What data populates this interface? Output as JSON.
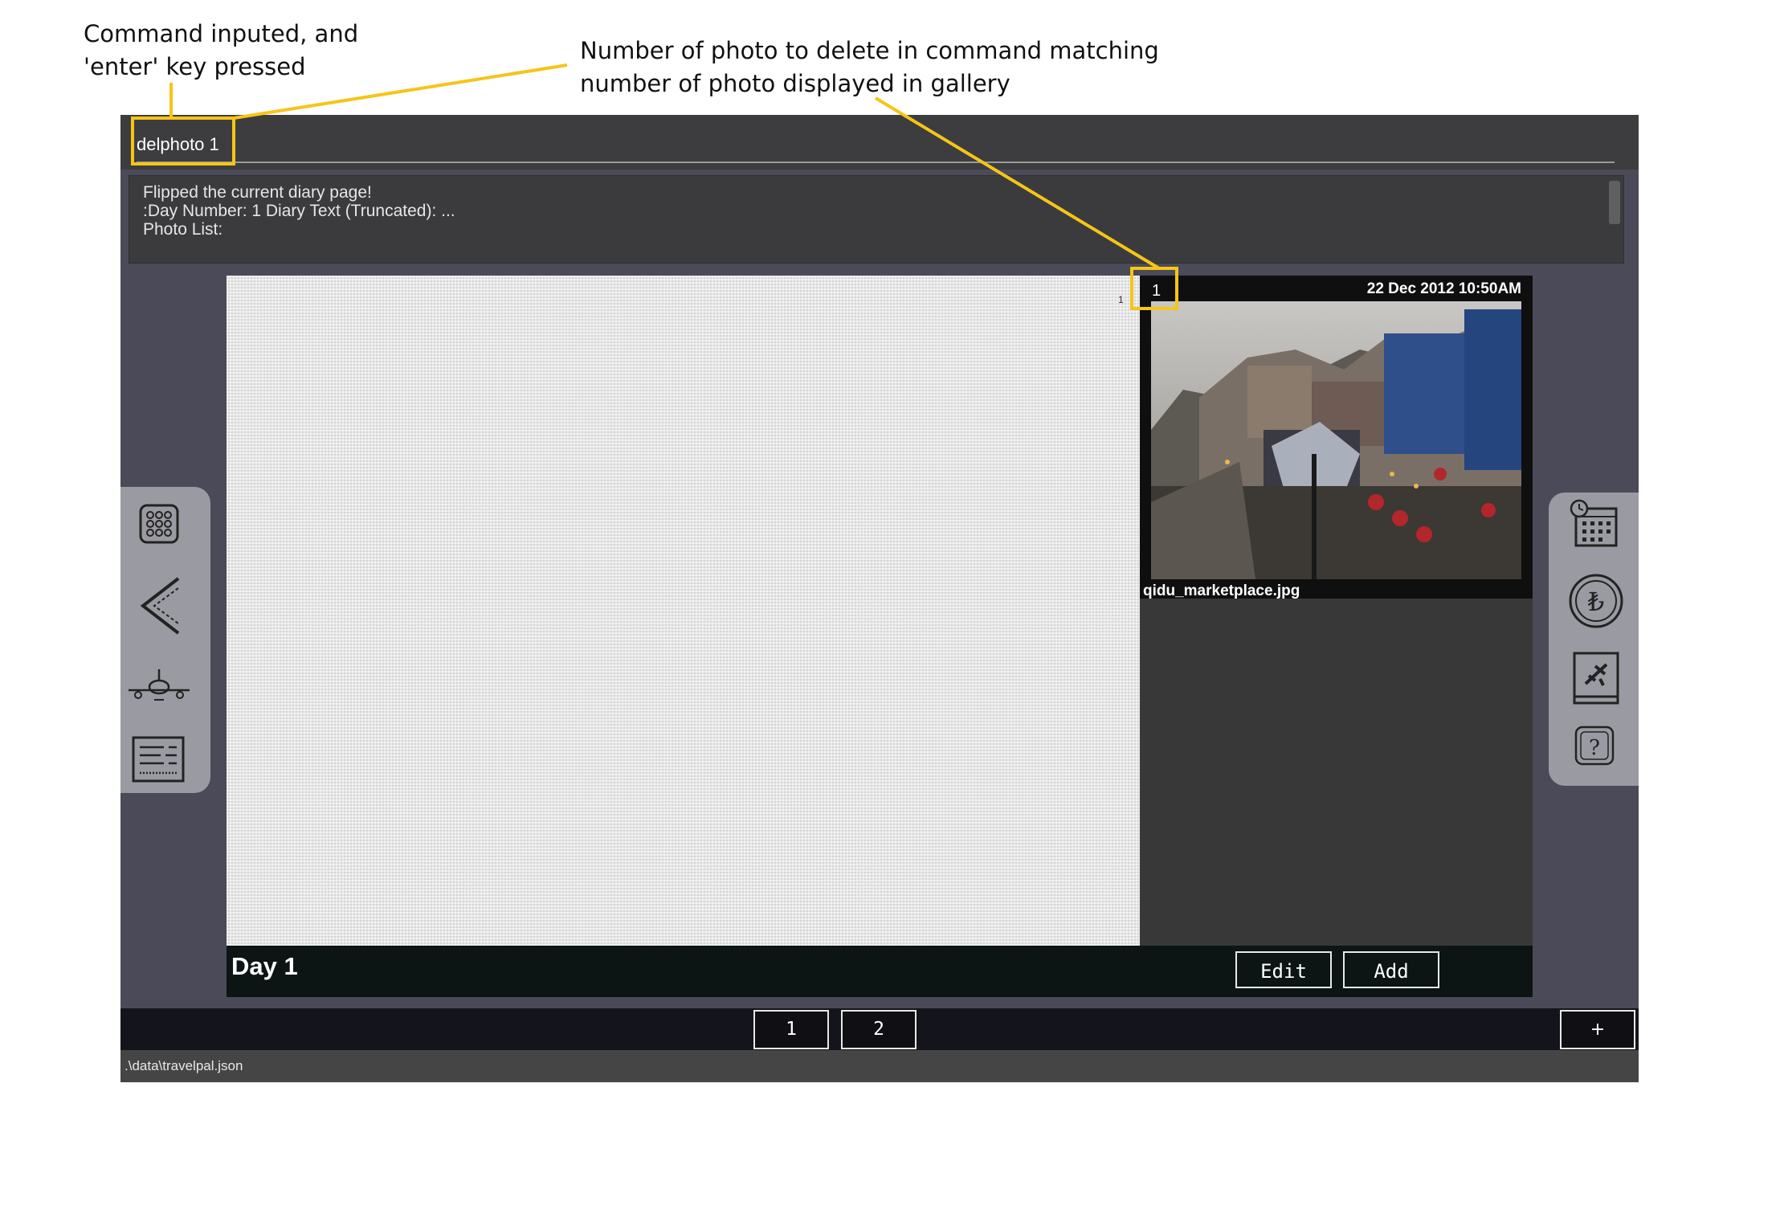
{
  "annotations": {
    "left": "Command inputed, and\n'enter' key pressed",
    "right": "Number of photo to delete in command matching\nnumber of photo displayed in gallery",
    "highlight_color": "#f5c518"
  },
  "command": {
    "value": "delphoto 1"
  },
  "result": {
    "lines": [
      "Flipped the current diary page!",
      ":Day Number: 1 Diary Text (Truncated): ...",
      "Photo List:"
    ]
  },
  "diary_page": {
    "page_number": "1",
    "day_label": "Day 1",
    "edit_label": "Edit",
    "add_label": "Add"
  },
  "gallery": {
    "photos": [
      {
        "index": "1",
        "date": "22 Dec 2012 10:50AM",
        "name": "qidu_marketplace.jpg"
      }
    ]
  },
  "left_nav": {
    "icons": [
      "calendar-grid-icon",
      "back-arrow-icon",
      "airplane-icon",
      "document-icon"
    ]
  },
  "right_nav": {
    "icons": [
      "calendar-clock-icon",
      "currency-icon",
      "travel-book-icon",
      "help-icon"
    ]
  },
  "page_tabs": {
    "tabs": [
      "1",
      "2"
    ],
    "add_label": "+"
  },
  "status": {
    "path": ".\\data\\travelpal.json"
  },
  "colors": {
    "app_background": "#4a4a58",
    "command_bar": "#3d3d3f",
    "footer_dark": "#0c1414",
    "nav_panel": "#9a9aa2"
  }
}
